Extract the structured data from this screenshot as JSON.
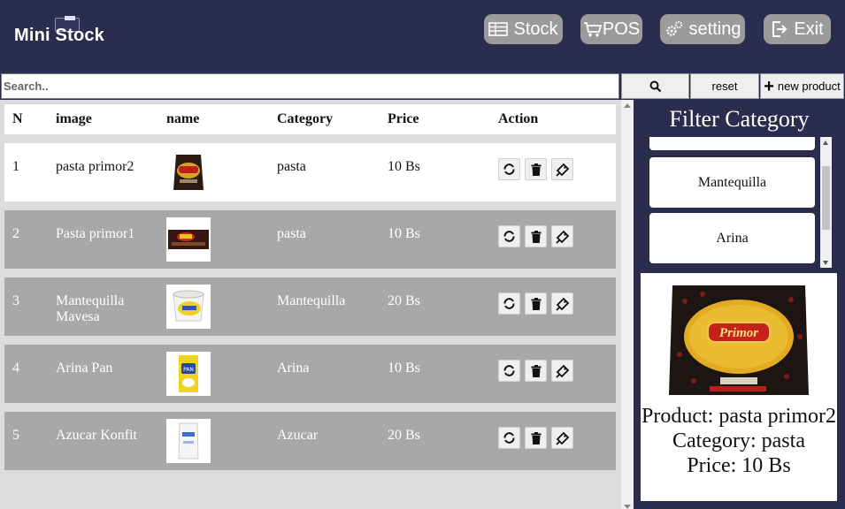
{
  "app": {
    "logo_text": "Mini Stock"
  },
  "nav": [
    {
      "label": "Stock",
      "icon": "table-icon"
    },
    {
      "label": "POS",
      "icon": "cart-icon"
    },
    {
      "label": "setting",
      "icon": "gears-icon"
    },
    {
      "label": "Exit",
      "icon": "exit-icon"
    }
  ],
  "search": {
    "placeholder": "Search..",
    "value": "",
    "reset_label": "reset",
    "new_label": "new product"
  },
  "table": {
    "headers": [
      "N",
      "image",
      "name",
      "Category",
      "Price",
      "Action"
    ],
    "rows": [
      {
        "n": "1",
        "name": "pasta primor2",
        "category": "pasta",
        "price": "10 Bs",
        "image": "pasta-primor-bag"
      },
      {
        "n": "2",
        "name": "Pasta primor1",
        "category": "pasta",
        "price": "10 Bs",
        "image": "pasta-primor-pack"
      },
      {
        "n": "3",
        "name": "Mantequilla Mavesa",
        "category": "Mantequilla",
        "price": "20 Bs",
        "image": "butter-tub"
      },
      {
        "n": "4",
        "name": "Arina Pan",
        "category": "Arina",
        "price": "10 Bs",
        "image": "flour-pack"
      },
      {
        "n": "5",
        "name": "Azucar Konfit",
        "category": "Azucar",
        "price": "20 Bs",
        "image": "sugar-bag"
      }
    ]
  },
  "filter": {
    "title": "Filter Category",
    "categories": [
      "Mantequilla",
      "Arina"
    ]
  },
  "detail": {
    "product": "Product: pasta primor2",
    "category": "Category: pasta",
    "price": "Price: 10 Bs"
  },
  "colors": {
    "header_bg": "#2b2d4f",
    "row_bg": "#a8a8a8",
    "nav_btn_bg": "#9b9b9b"
  }
}
